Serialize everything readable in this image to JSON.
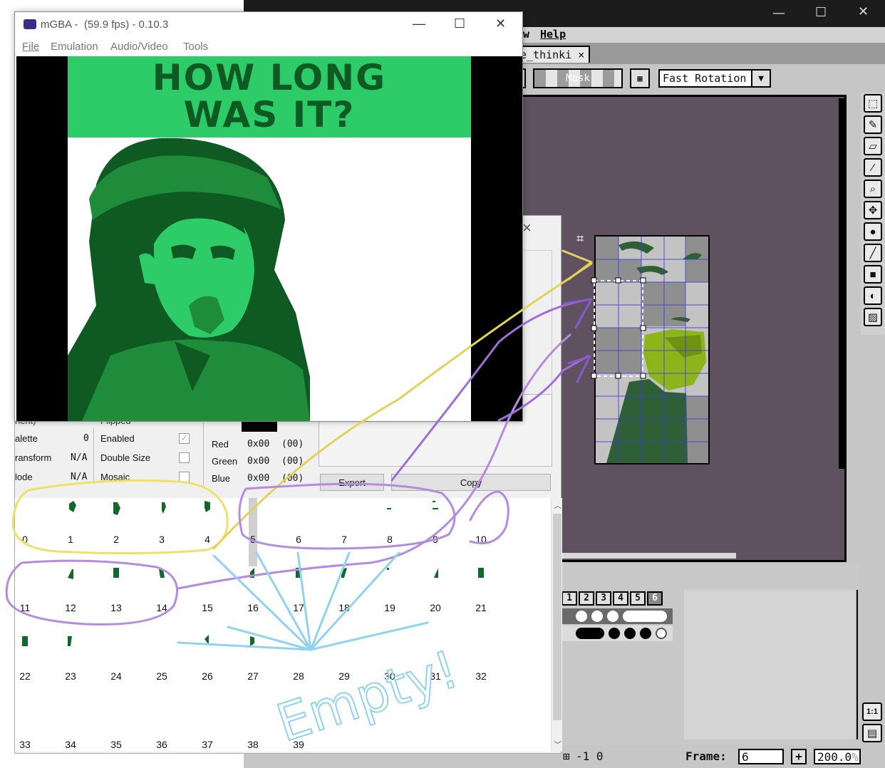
{
  "aseprite": {
    "menu": {
      "view_partial": "w",
      "help": "Help"
    },
    "tab_label": "e_thinki",
    "tab_close": "×",
    "mask_button": "Mask",
    "rotation_select": "Fast Rotation",
    "brush_sizes": [
      "1",
      "2",
      "3",
      "4",
      "5",
      "6"
    ],
    "status_coords": "-1 0",
    "frame_label": "Frame:",
    "frame_value": "6",
    "frame_add": "+",
    "zoom_value": "200.0",
    "zoom_suffix": "%",
    "zoom_button": "1:1",
    "colors": {
      "canvas_bg": "#5f5160",
      "sprite_light": "#c3c3c3",
      "sprite_mid": "#8f8f8f",
      "sprite_dark": "#2f5f34",
      "sprite_yellowgreen": "#8db51b",
      "grid": "#3b3be6"
    }
  },
  "mgba": {
    "title": "mGBA -  (59.9 fps) - 0.10.3",
    "menu": [
      "File",
      "Emulation",
      "Audio/Video",
      "Tools"
    ],
    "screen_text_line1": "HOW LONG",
    "screen_text_line2": "WAS IT?",
    "colors": {
      "light": "#2ecc68",
      "dark": "#0f5a23",
      "mid": "#1e8c3a"
    }
  },
  "tile_viewer": {
    "close": "×",
    "left_labels": [
      "nent)",
      "alette",
      "ransform",
      "lode"
    ],
    "left_values": [
      "",
      "0",
      "N/A",
      "N/A"
    ],
    "mid_labels": [
      "Flipped",
      "Enabled",
      "Double Size",
      "Mosaic"
    ],
    "color_labels": [
      "Red",
      "Green",
      "Blue"
    ],
    "color_hex": [
      "0x00",
      "0x00",
      "0x00"
    ],
    "color_dec": [
      "(00)",
      "(00)",
      "(00)"
    ],
    "export_button": "Export",
    "copy_button": "Copy",
    "tile_numbers": [
      "0",
      "1",
      "2",
      "3",
      "4",
      "5",
      "6",
      "7",
      "8",
      "9",
      "10",
      "11",
      "12",
      "13",
      "14",
      "15",
      "16",
      "17",
      "18",
      "19",
      "20",
      "21",
      "22",
      "23",
      "24",
      "25",
      "26",
      "27",
      "28",
      "29",
      "30",
      "31",
      "32",
      "33",
      "34",
      "35",
      "36",
      "37",
      "38",
      "39"
    ]
  },
  "annotation": {
    "text": "Empty!"
  }
}
